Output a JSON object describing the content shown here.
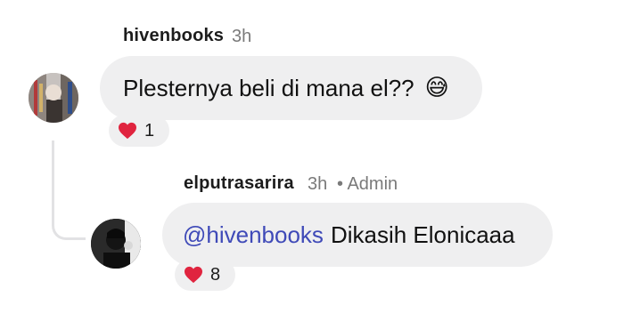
{
  "comments": [
    {
      "username": "hivenbooks",
      "time": "3h",
      "text": "Plesternya beli di mana el??",
      "emoji": "😅",
      "reaction": {
        "icon": "heart",
        "count": "1"
      }
    },
    {
      "username": "elputrasarira",
      "time": "3h",
      "role": "• Admin",
      "mention": "@hivenbooks",
      "text": "Dikasih Elonicaaa",
      "reaction": {
        "icon": "heart",
        "count": "8"
      }
    }
  ],
  "colors": {
    "bubble": "#efeff0",
    "mention": "#3f4ab8",
    "heart": "#e0243f",
    "thread_line": "#e2e2e4"
  }
}
